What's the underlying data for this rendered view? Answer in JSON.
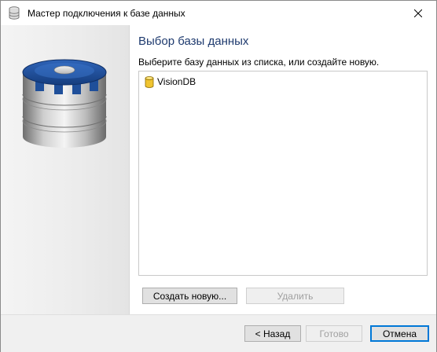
{
  "window": {
    "title": "Мастер подключения к базе данных",
    "icon": "database-icon"
  },
  "content": {
    "heading": "Выбор базы данных",
    "instruction": "Выберите базу данных из списка, или создайте новую.",
    "databases": [
      {
        "name": "VisionDB",
        "icon": "database-icon"
      }
    ],
    "create_button": "Создать новую...",
    "delete_button": "Удалить"
  },
  "footer": {
    "back_button": "< Назад",
    "finish_button": "Готово",
    "cancel_button": "Отмена"
  },
  "colors": {
    "heading": "#1e3a6e",
    "accent": "#0078d7",
    "db_blue": "#1f4f9a",
    "db_gold": "#f0c430"
  }
}
